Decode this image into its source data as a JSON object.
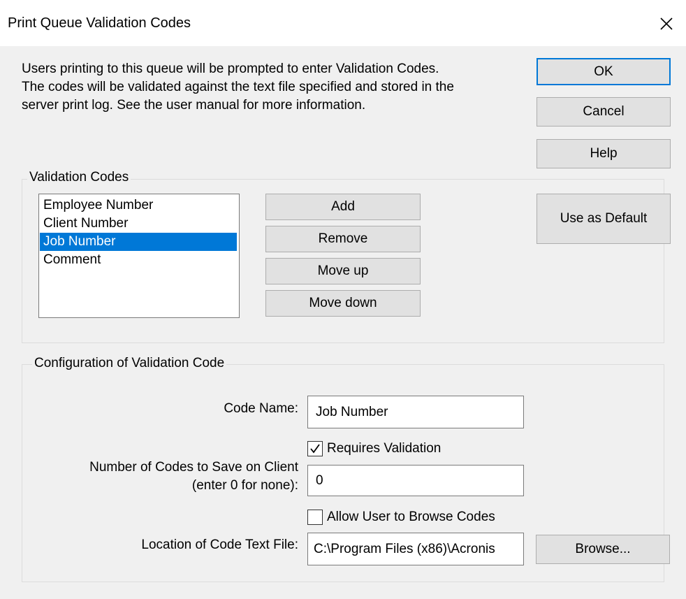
{
  "window": {
    "title": "Print Queue Validation Codes"
  },
  "intro": {
    "lines": [
      "Users printing to this queue will be prompted to enter Validation Codes.",
      "The codes will be validated against the text file specified and stored in the",
      "server print log.  See the user manual for more information."
    ]
  },
  "buttons": {
    "ok": "OK",
    "cancel": "Cancel",
    "help": "Help",
    "add": "Add",
    "remove": "Remove",
    "move_up": "Move up",
    "move_down": "Move down",
    "use_as_default": "Use as Default",
    "browse": "Browse..."
  },
  "validation_codes": {
    "group_label": "Validation Codes",
    "items": [
      {
        "label": "Employee Number",
        "selected": false
      },
      {
        "label": "Client Number",
        "selected": false
      },
      {
        "label": "Job Number",
        "selected": true
      },
      {
        "label": "Comment",
        "selected": false
      }
    ]
  },
  "configuration": {
    "group_label": "Configuration of Validation Code",
    "code_name_label": "Code Name:",
    "code_name_value": "Job Number",
    "requires_validation_label": "Requires Validation",
    "requires_validation_checked": true,
    "num_codes_label_line1": "Number of Codes to Save on Client",
    "num_codes_label_line2": "(enter 0 for none):",
    "num_codes_value": "0",
    "allow_browse_label": "Allow User to Browse Codes",
    "allow_browse_checked": false,
    "location_label": "Location of Code Text File:",
    "location_value": "C:\\Program Files (x86)\\Acronis"
  },
  "colors": {
    "accent": "#0078d7",
    "dialog_bg": "#f0f0f0",
    "button_bg": "#e1e1e1"
  }
}
